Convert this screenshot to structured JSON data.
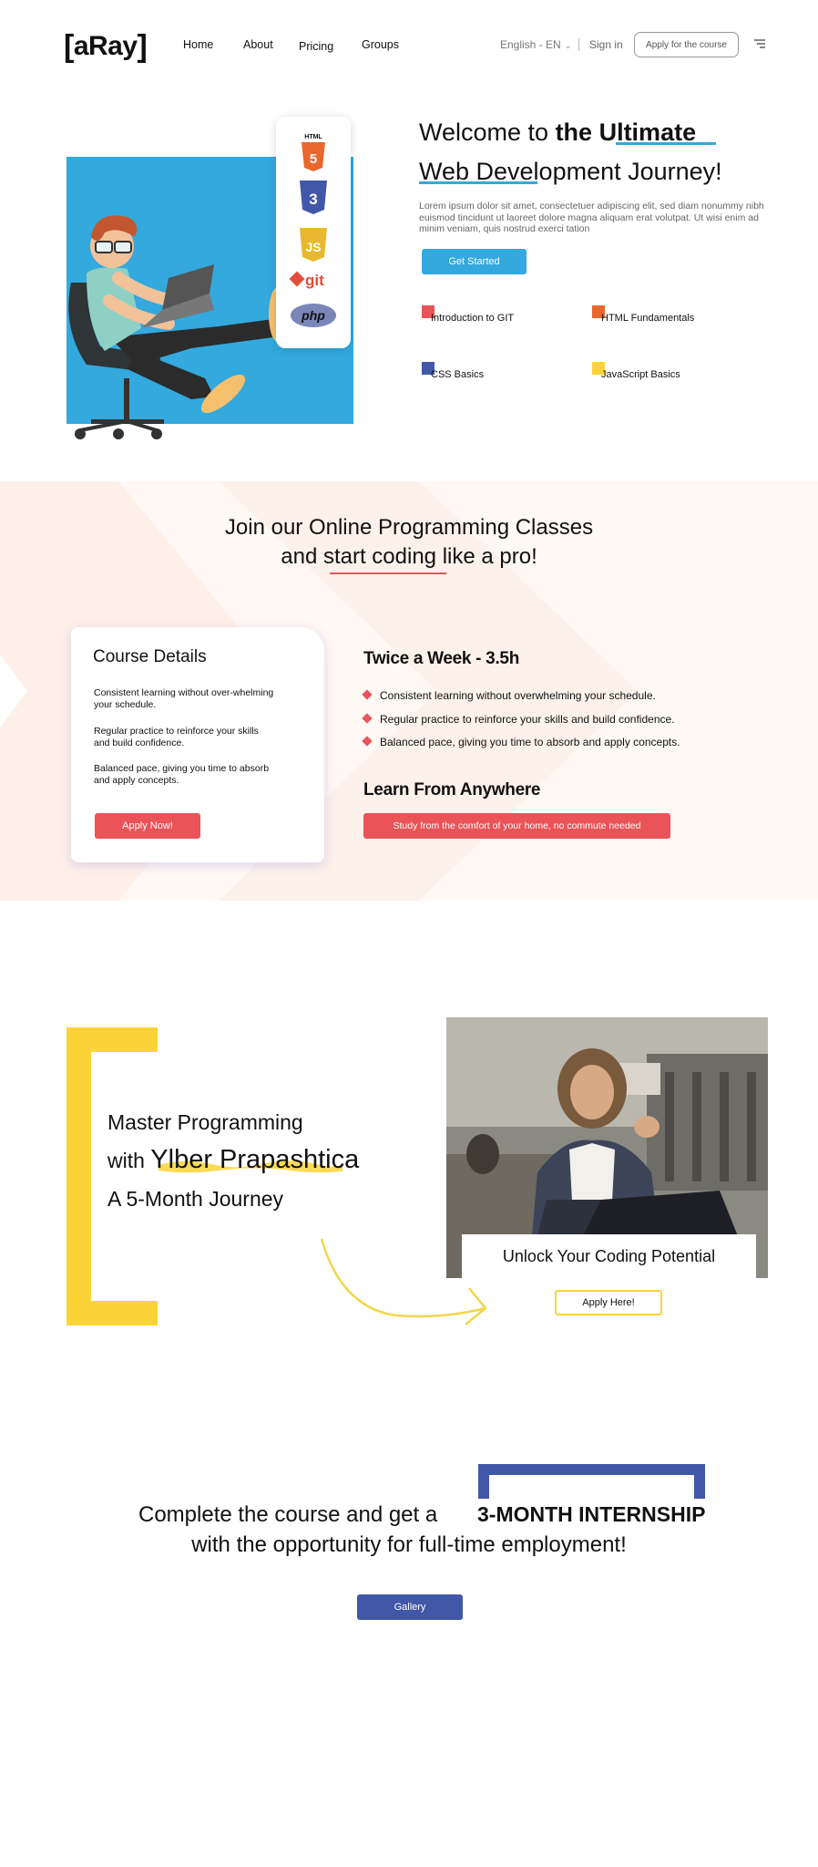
{
  "nav": {
    "logo": "aRay",
    "links": [
      "Home",
      "About",
      "Pricing",
      "Groups"
    ],
    "language": "English - EN",
    "signin": "Sign in",
    "apply": "Apply for the course"
  },
  "hero": {
    "title_line1_a": "Welcome to ",
    "title_line1_b": "the Ultimate",
    "title_line2": "Web Development Journey!",
    "description": "Lorem ipsum dolor sit amet, consectetuer adipiscing elit, sed diam nonummy nibh euismod tincidunt ut laoreet dolore magna aliquam erat volutpat. Ut wisi enim ad minim veniam, quis nostrud exerci tation",
    "cta": "Get Started",
    "tech_labels": {
      "html": "HTML",
      "html_num": "5",
      "css_num": "3",
      "js": "JS",
      "git": "git",
      "php": "php"
    },
    "topics": [
      {
        "label": "Introduction to GIT",
        "color": "#ea5358"
      },
      {
        "label": "HTML Fundamentals",
        "color": "#e9672e"
      },
      {
        "label": "CSS Basics",
        "color": "#4157a8"
      },
      {
        "label": "JavaScript Basics",
        "color": "#fcd337"
      }
    ]
  },
  "classes": {
    "heading_line1": "Join our Online Programming Classes",
    "heading_line2": "and start coding like a pro!",
    "card": {
      "title": "Course Details",
      "points": [
        "Consistent learning without  over-whelming your schedule.",
        "Regular practice to reinforce your skills and build confidence.",
        "Balanced pace, giving you time to absorb and apply concepts."
      ],
      "cta": "Apply Now!"
    },
    "schedule_title": "Twice a Week - 3.5h",
    "bullets": [
      "Consistent learning without  overwhelming your schedule.",
      "Regular practice to reinforce your skills and build confidence.",
      "Balanced pace, giving you time to absorb and apply concepts."
    ],
    "anywhere_title": "Learn From Anywhere",
    "anywhere_badge": "Study from the comfort of your home, no commute needed"
  },
  "master": {
    "line1": "Master Programming",
    "line2_prefix": "with ",
    "line2_name": "Ylber Prapashtica",
    "line3": "A 5-Month Journey",
    "photo_caption": "Unlock Your Coding Potential",
    "cta": "Apply Here!"
  },
  "internship": {
    "line1": "Complete the course and get a",
    "highlight": "3-MONTH INTERNSHIP",
    "line2": "with the opportunity for full-time employment!",
    "cta": "Gallery"
  },
  "colors": {
    "blue": "#33a9dd",
    "red": "#ea5358",
    "yellow": "#fcd337",
    "navy": "#4157a8",
    "orange": "#e9672e"
  }
}
